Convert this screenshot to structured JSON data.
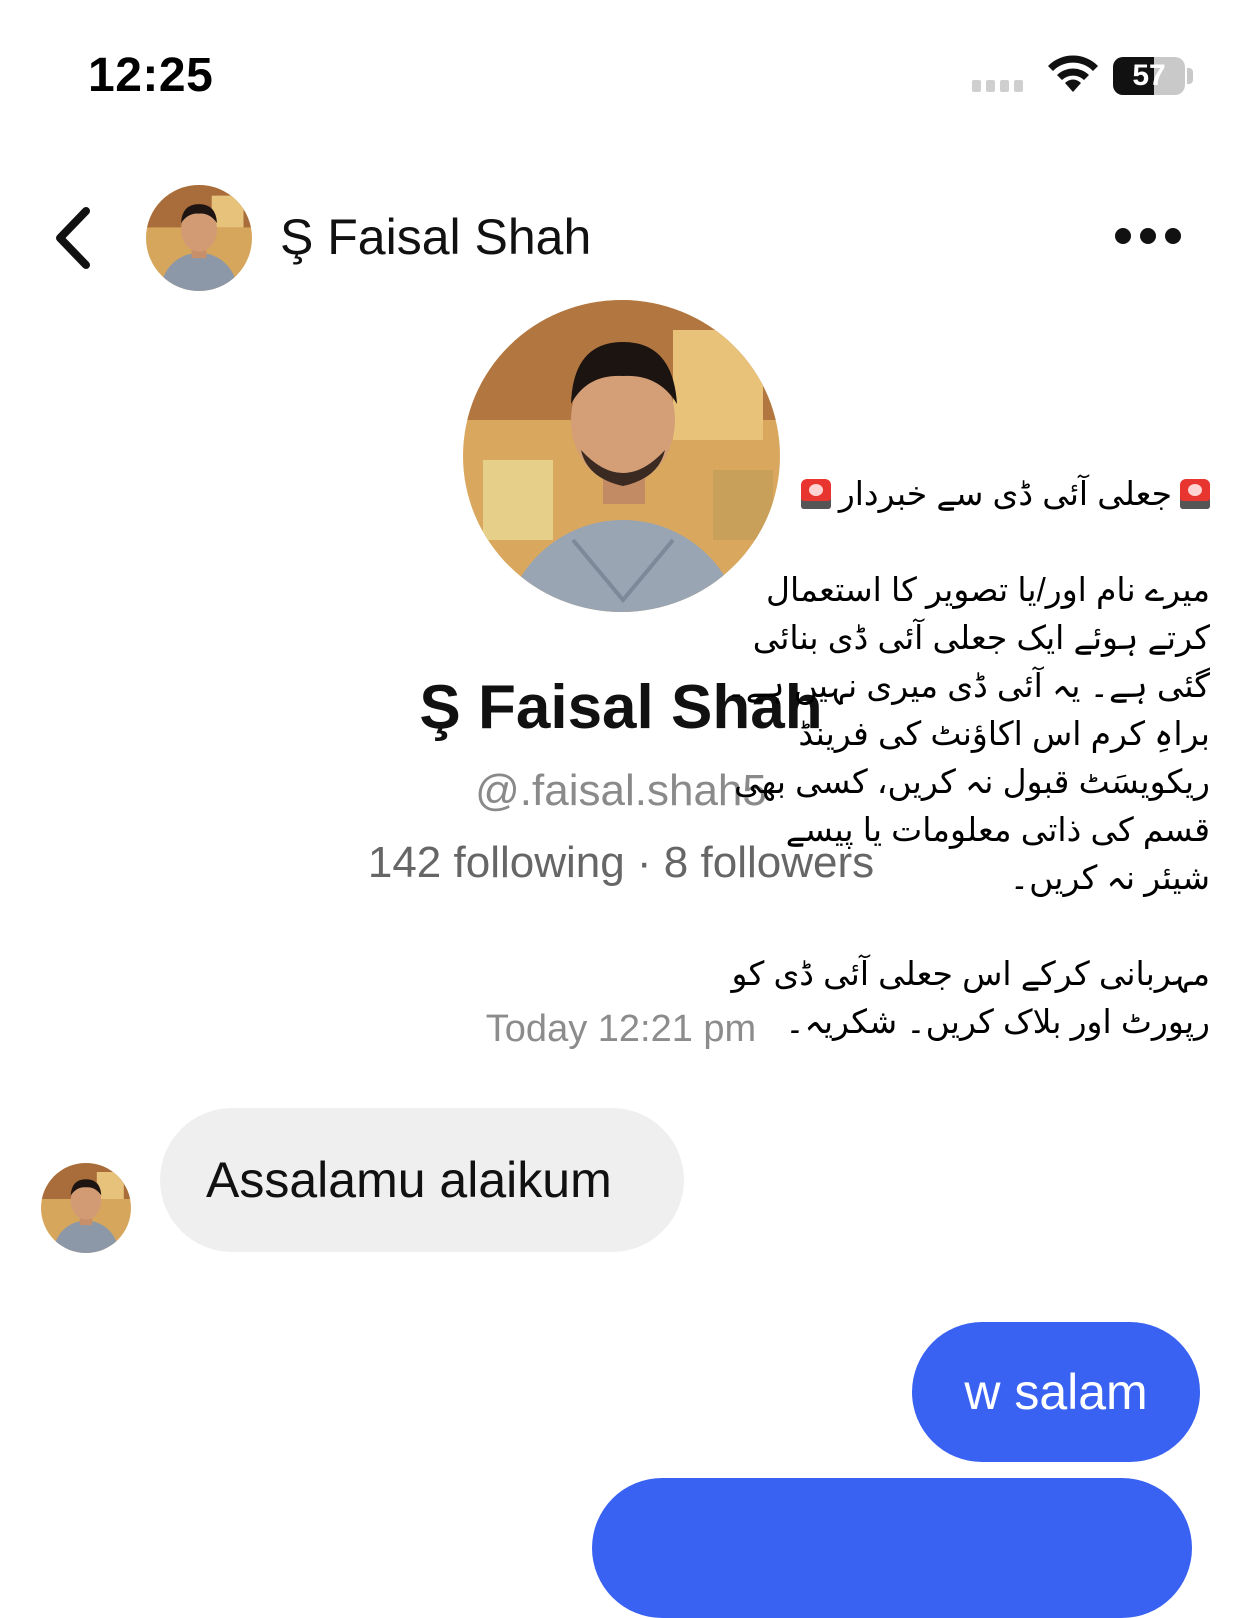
{
  "status_bar": {
    "time": "12:25",
    "battery": "57",
    "battery_level_percent": 57,
    "icons": [
      "signal-icon",
      "wifi-icon",
      "battery-icon"
    ]
  },
  "header": {
    "back_icon": "chevron-left-icon",
    "contact_name": "Ş Faisal Shah",
    "more_icon": "more-horizontal-icon"
  },
  "profile": {
    "name": "Ş Faisal Shah",
    "handle": "@.faisal.shah5",
    "stats": "142 following · 8 followers"
  },
  "notice": {
    "title": "جعلی آئی ڈی سے خبردار",
    "lines_1": [
      "میرے نام اور/یا تصویر کا استعمال",
      "کرتے ہوئے ایک جعلی آئی ڈی بنائی",
      "گئی ہے۔ یہ آئی ڈی میری نہیں ہے۔",
      "براہِ کرم اس اکاؤنٹ کی فرینڈ",
      "ریکویسَٹ قبول نہ کریں، کسی بھی",
      "قسم کی ذاتی معلومات یا پیسے",
      "شیئر نہ کریں۔"
    ],
    "lines_2": [
      "مہربانی کرکے اس جعلی آئی ڈی کو",
      "رپورٹ اور بلاک کریں۔ شکریہ۔"
    ]
  },
  "conversation": {
    "timestamp": "Today 12:21 pm",
    "messages": [
      {
        "direction": "incoming",
        "text": "Assalamu alaikum"
      },
      {
        "direction": "outgoing",
        "text": "w salam"
      },
      {
        "direction": "outgoing",
        "text": ""
      }
    ]
  },
  "colors": {
    "outgoing_bubble": "#3a62f2",
    "incoming_bubble": "#efefef",
    "secondary_text": "#8a8a8a"
  }
}
